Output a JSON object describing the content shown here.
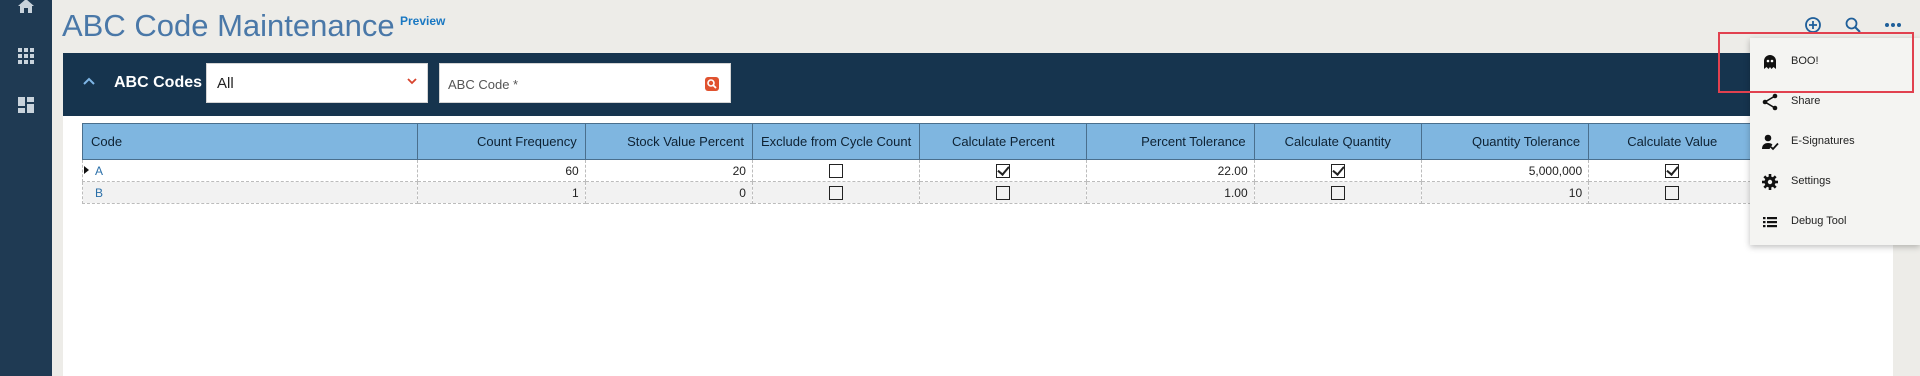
{
  "page": {
    "title": "ABC Code Maintenance",
    "preview_label": "Preview"
  },
  "rail": {
    "icons": [
      "home-icon",
      "apps-grid-icon",
      "dashboard-icon"
    ]
  },
  "top_actions": [
    "add-circle-icon",
    "search-icon",
    "more-horizontal-icon"
  ],
  "panel": {
    "title": "ABC Codes",
    "filter": {
      "selected": "All"
    },
    "search": {
      "placeholder": "ABC Code *",
      "value": ""
    }
  },
  "table": {
    "columns": [
      "Code",
      "Count Frequency",
      "Stock Value Percent",
      "Exclude from Cycle Count",
      "Calculate Percent",
      "Percent Tolerance",
      "Calculate Quantity",
      "Quantity Tolerance",
      "Calculate Value",
      ""
    ],
    "rows": [
      {
        "code": "A",
        "count_frequency": "60",
        "stock_value_percent": "20",
        "exclude_from_cycle_count": false,
        "calculate_percent": true,
        "percent_tolerance": "22.00",
        "calculate_quantity": true,
        "quantity_tolerance": "5,000,000",
        "calculate_value": true
      },
      {
        "code": "B",
        "count_frequency": "1",
        "stock_value_percent": "0",
        "exclude_from_cycle_count": false,
        "calculate_percent": false,
        "percent_tolerance": "1.00",
        "calculate_quantity": false,
        "quantity_tolerance": "10",
        "calculate_value": false
      }
    ]
  },
  "menu": {
    "items": [
      {
        "label": "BOO!",
        "icon": "ghost-icon"
      },
      {
        "label": "Share",
        "icon": "share-icon"
      },
      {
        "label": "E-Signatures",
        "icon": "e-signature-icon"
      },
      {
        "label": "Settings",
        "icon": "gear-icon"
      },
      {
        "label": "Debug Tool",
        "icon": "list-icon"
      }
    ]
  },
  "colors": {
    "accent": "#e1414f",
    "header_bg": "#16344e",
    "rail_bg": "#1f3a53",
    "grid_header": "#7fb6e0",
    "title": "#4a78a8"
  }
}
